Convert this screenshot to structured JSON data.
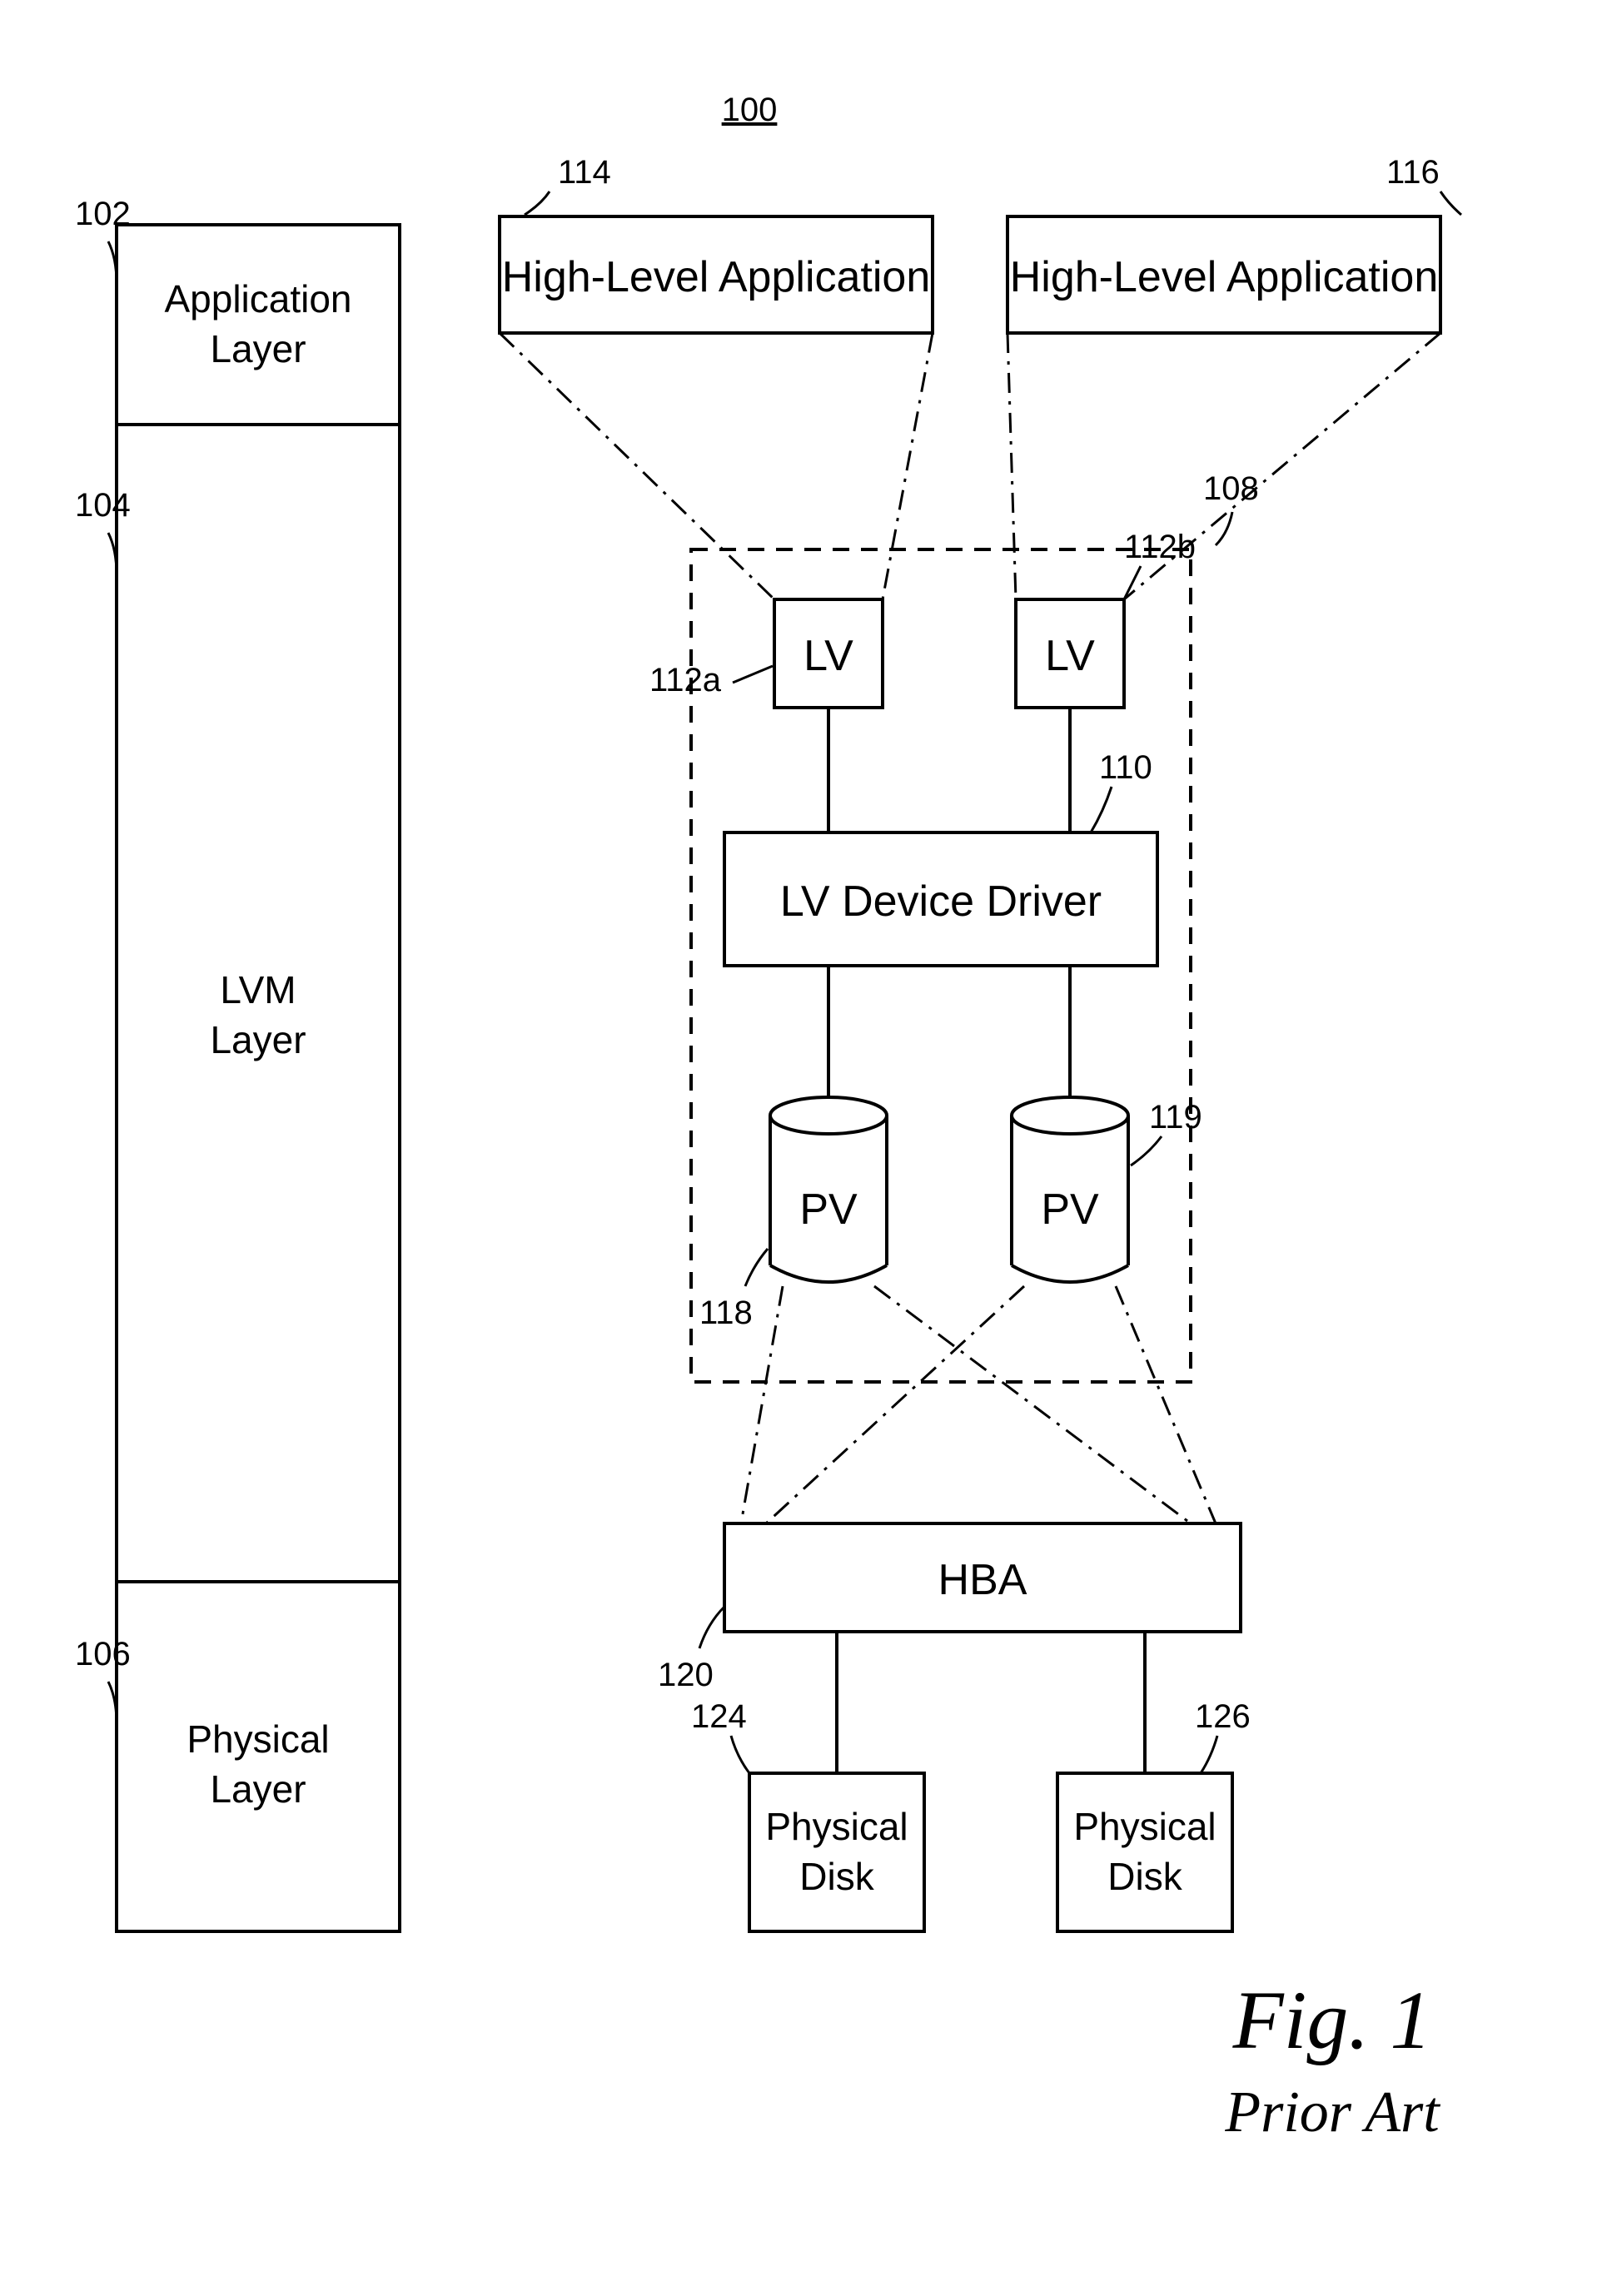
{
  "figure_ref": "100",
  "caption": {
    "fig": "Fig. 1",
    "prior": "Prior Art"
  },
  "layers": {
    "app": {
      "label1": "Application",
      "label2": "Layer",
      "ref": "102"
    },
    "lvm": {
      "label1": "LVM",
      "label2": "Layer",
      "ref": "104"
    },
    "phys": {
      "label1": "Physical",
      "label2": "Layer",
      "ref": "106"
    }
  },
  "apps": {
    "a": {
      "label": "High-Level Application",
      "ref": "114"
    },
    "b": {
      "label": "High-Level Application",
      "ref": "116"
    }
  },
  "lvm_group": {
    "ref": "108"
  },
  "lv": {
    "a": {
      "label": "LV",
      "ref": "112a"
    },
    "b": {
      "label": "LV",
      "ref": "112b"
    }
  },
  "driver": {
    "label": "LV Device Driver",
    "ref": "110"
  },
  "pv": {
    "a": {
      "label": "PV",
      "ref": "118"
    },
    "b": {
      "label": "PV",
      "ref": "119"
    }
  },
  "hba": {
    "label": "HBA",
    "ref": "120"
  },
  "disks": {
    "a": {
      "label1": "Physical",
      "label2": "Disk",
      "ref": "124"
    },
    "b": {
      "label1": "Physical",
      "label2": "Disk",
      "ref": "126"
    }
  }
}
